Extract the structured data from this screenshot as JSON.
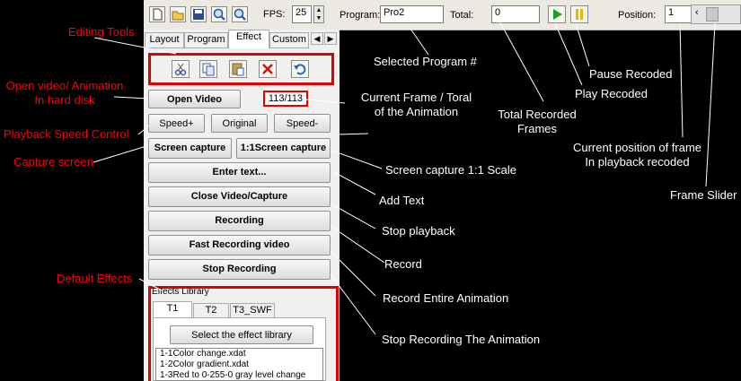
{
  "toolbar": {
    "fps_label": "FPS:",
    "fps_value": "25",
    "program_label": "Program:",
    "program_value": "Pro2",
    "total_label": "Total:",
    "total_value": "0",
    "position_label": "Position:",
    "position_value": "1"
  },
  "tabs": [
    "Layout",
    "Program",
    "Effect",
    "Custom"
  ],
  "frame_counter": "113/113",
  "buttons": {
    "open_video": "Open Video",
    "speed_up": "Speed+",
    "original": "Original",
    "speed_down": "Speed-",
    "screen_capture": "Screen capture",
    "screen_capture_11": "1:1Screen capture",
    "enter_text": "Enter text...",
    "close_video": "Close Video/Capture",
    "recording": "Recording",
    "fast_recording": "Fast Recording video",
    "stop_recording": "Stop Recording"
  },
  "effects": {
    "group_label": "Effects Library",
    "tabs": [
      "T1",
      "T2",
      "T3_SWF"
    ],
    "select_button": "Select the effect library",
    "list": [
      "1-1Color change.xdat",
      "1-2Color gradient.xdat",
      "1-3Red to 0-255-0 gray level change"
    ]
  },
  "annotations": {
    "editing_tools": "Editing Tools",
    "open_video_1": "Open video/ Animation",
    "open_video_2": "In hard disk",
    "playback_speed": "Playback Speed Control",
    "capture_screen": "Capture screen",
    "default_effects": "Default Effects",
    "selected_program": "Selected Program #",
    "current_frame_1": "Current Frame / Toral",
    "current_frame_2": "of the Animation",
    "total_recorded_1": "Total Recorded",
    "total_recorded_2": "Frames",
    "pause_recoded": "Pause Recoded",
    "play_recoded": "Play Recoded",
    "current_position_1": "Current position of frame",
    "current_position_2": "In playback recoded",
    "frame_slider": "Frame Slider",
    "screen_capture_scale": "Screen capture 1:1 Scale",
    "add_text": "Add Text",
    "stop_playback": "Stop playback",
    "record": "Record",
    "record_entire": "Record Entire Animation",
    "stop_recording_anim": "Stop Recording The Animation"
  },
  "colors": {
    "annotation_red": "#ff0000",
    "annotation_white": "#ffffff",
    "panel_bg": "#f0f0f0",
    "play_green": "#1aa31a",
    "pause_yellow": "#e0b800"
  }
}
